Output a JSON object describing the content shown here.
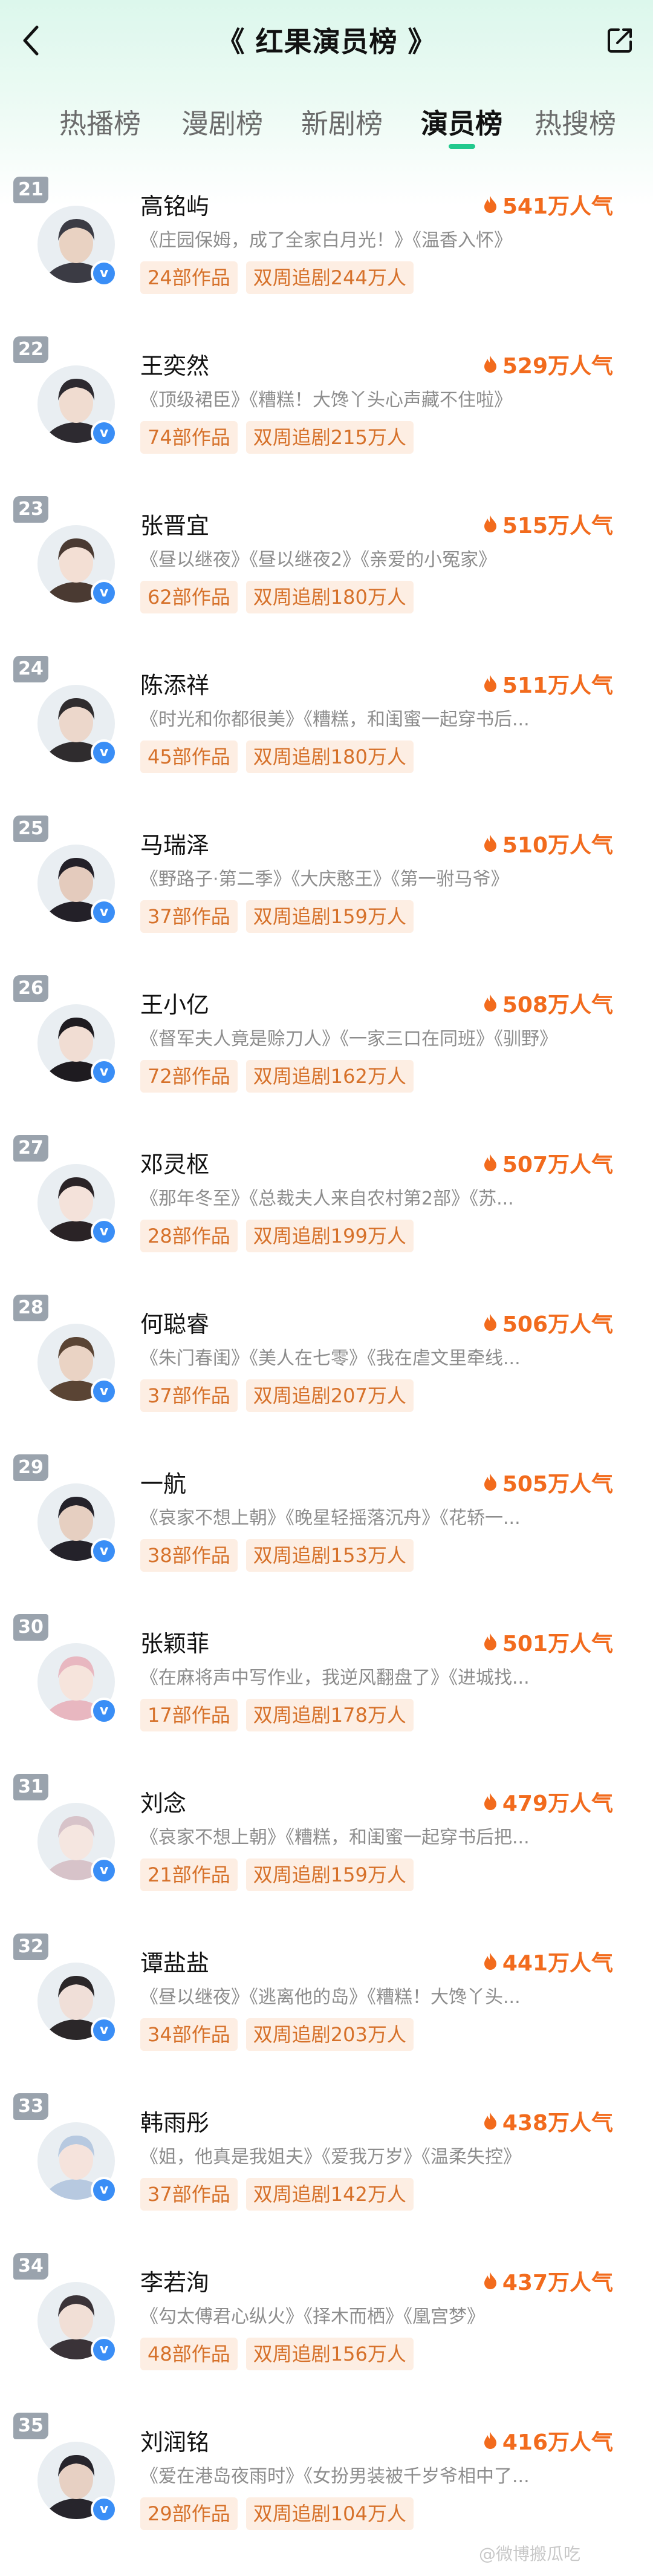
{
  "header": {
    "title": "《 红果演员榜 》"
  },
  "tabs": [
    {
      "label": "热播榜",
      "active": false
    },
    {
      "label": "漫剧榜",
      "active": false
    },
    {
      "label": "新剧榜",
      "active": false
    },
    {
      "label": "演员榜",
      "active": true
    },
    {
      "label": "热搜榜",
      "active": false
    }
  ],
  "colors": {
    "accent": "#22c98d",
    "heat": "#f26b1d",
    "tag_bg": "#fdeee3",
    "tag_text": "#d6712a",
    "rank_badge": "#9aa3ad",
    "verified": "#3a8ef6"
  },
  "icons": {
    "back": "chevron-left-icon",
    "share": "share-icon",
    "heat": "flame-icon",
    "verified": "verified-badge-icon"
  },
  "actors": [
    {
      "rank": "21",
      "name": "高铭屿",
      "heat": "541万人气",
      "works": "《庄园保姆，成了全家白月光！》《温香入怀》",
      "count": "24部作品",
      "follow": "双周追剧244万人"
    },
    {
      "rank": "22",
      "name": "王奕然",
      "heat": "529万人气",
      "works": "《顶级裙臣》《糟糕！大馋丫头心声藏不住啦》",
      "count": "74部作品",
      "follow": "双周追剧215万人"
    },
    {
      "rank": "23",
      "name": "张晋宜",
      "heat": "515万人气",
      "works": "《昼以继夜》《昼以继夜2》《亲爱的小冤家》",
      "count": "62部作品",
      "follow": "双周追剧180万人"
    },
    {
      "rank": "24",
      "name": "陈添祥",
      "heat": "511万人气",
      "works": "《时光和你都很美》《糟糕，和闺蜜一起穿书后...",
      "count": "45部作品",
      "follow": "双周追剧180万人"
    },
    {
      "rank": "25",
      "name": "马瑞泽",
      "heat": "510万人气",
      "works": "《野路子·第二季》《大庆憨王》《第一驸马爷》",
      "count": "37部作品",
      "follow": "双周追剧159万人"
    },
    {
      "rank": "26",
      "name": "王小亿",
      "heat": "508万人气",
      "works": "《督军夫人竟是赊刀人》《一家三口在同班》《驯野》",
      "count": "72部作品",
      "follow": "双周追剧162万人"
    },
    {
      "rank": "27",
      "name": "邓灵枢",
      "heat": "507万人气",
      "works": "《那年冬至》《总裁夫人来自农村第2部》《苏...",
      "count": "28部作品",
      "follow": "双周追剧199万人"
    },
    {
      "rank": "28",
      "name": "何聪睿",
      "heat": "506万人气",
      "works": "《朱门春闺》《美人在七零》《我在虐文里牵线...",
      "count": "37部作品",
      "follow": "双周追剧207万人"
    },
    {
      "rank": "29",
      "name": "一航",
      "heat": "505万人气",
      "works": "《哀家不想上朝》《晚星轻摇落沉舟》《花轿一...",
      "count": "38部作品",
      "follow": "双周追剧153万人"
    },
    {
      "rank": "30",
      "name": "张颖菲",
      "heat": "501万人气",
      "works": "《在麻将声中写作业，我逆风翻盘了》《进城找...",
      "count": "17部作品",
      "follow": "双周追剧178万人"
    },
    {
      "rank": "31",
      "name": "刘念",
      "heat": "479万人气",
      "works": "《哀家不想上朝》《糟糕，和闺蜜一起穿书后把...",
      "count": "21部作品",
      "follow": "双周追剧159万人"
    },
    {
      "rank": "32",
      "name": "谭盐盐",
      "heat": "441万人气",
      "works": "《昼以继夜》《逃离他的岛》《糟糕！大馋丫头...",
      "count": "34部作品",
      "follow": "双周追剧203万人"
    },
    {
      "rank": "33",
      "name": "韩雨彤",
      "heat": "438万人气",
      "works": "《姐，他真是我姐夫》《爱我万岁》《温柔失控》",
      "count": "37部作品",
      "follow": "双周追剧142万人"
    },
    {
      "rank": "34",
      "name": "李若洵",
      "heat": "437万人气",
      "works": "《勾太傅君心纵火》《择木而栖》《凰宫梦》",
      "count": "48部作品",
      "follow": "双周追剧156万人"
    },
    {
      "rank": "35",
      "name": "刘润铭",
      "heat": "416万人气",
      "works": "《爱在港岛夜雨时》《女扮男装被千岁爷相中了...",
      "count": "29部作品",
      "follow": "双周追剧104万人"
    }
  ],
  "watermark": "@微博搬瓜吃"
}
